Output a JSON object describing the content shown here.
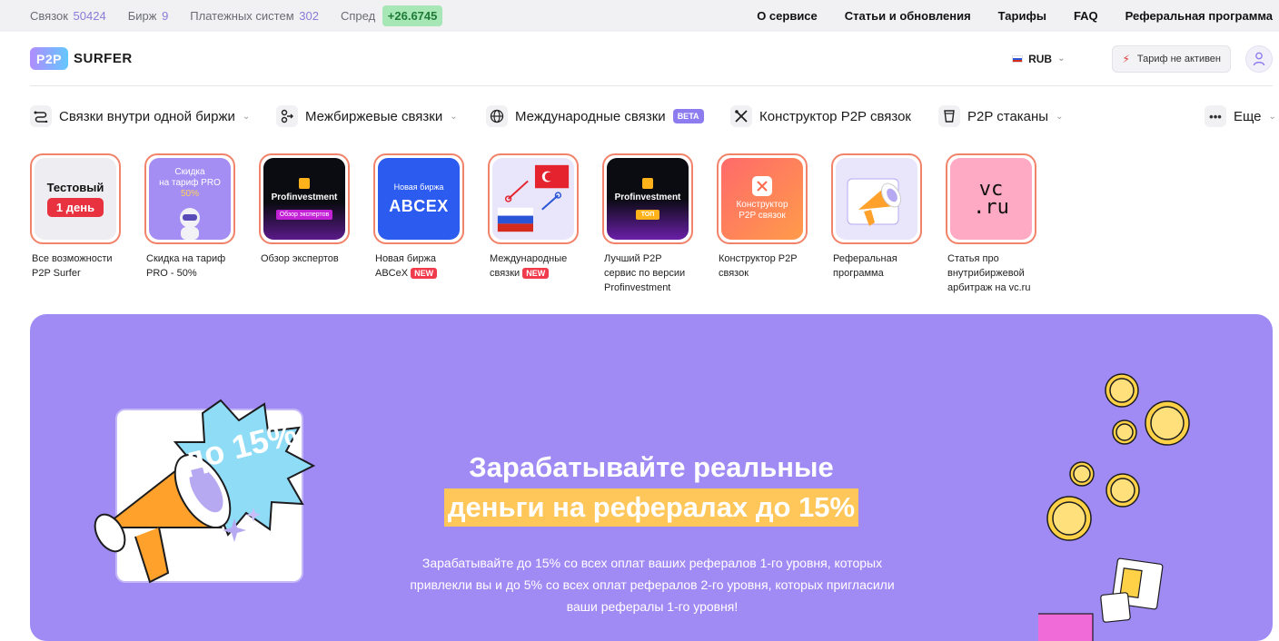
{
  "topbar": {
    "stats": [
      {
        "label": "Связок",
        "value": "50424"
      },
      {
        "label": "Бирж",
        "value": "9"
      },
      {
        "label": "Платежных систем",
        "value": "302"
      }
    ],
    "spread_label": "Спред",
    "spread_value": "+26.6745",
    "nav": [
      "О сервисе",
      "Статьи и обновления",
      "Тарифы",
      "FAQ",
      "Реферальная программа"
    ]
  },
  "header": {
    "logo_badge": "P2P",
    "logo_text": "SURFER",
    "currency": "RUB",
    "tariff_button": "Тариф не активен"
  },
  "menu": {
    "items": [
      {
        "label": "Связки внутри одной биржи",
        "icon": "route-icon"
      },
      {
        "label": "Межбиржевые связки",
        "icon": "exchange-icon"
      },
      {
        "label": "Международные связки",
        "icon": "globe-icon",
        "badge": "BETA"
      },
      {
        "label": "Конструктор P2P связок",
        "icon": "tools-icon"
      },
      {
        "label": "P2P стаканы",
        "icon": "cup-icon"
      }
    ],
    "more_label": "Еще"
  },
  "stories": [
    {
      "thumb_lines": [
        "Тестовый",
        "1 день"
      ],
      "caption": "Все возможности P2P Surfer"
    },
    {
      "thumb_lines": [
        "Скидка",
        "на тариф PRO",
        "50%"
      ],
      "caption": "Скидка на тариф PRO - 50%"
    },
    {
      "thumb_lines": [
        "Profinvestment",
        "Обзор экспертов"
      ],
      "caption": "Обзор экспертов"
    },
    {
      "thumb_lines": [
        "Новая биржа",
        "ABCEX"
      ],
      "caption": "Новая биржа ABCeX",
      "badge": "NEW"
    },
    {
      "thumb_lines": [],
      "caption": "Международные связки",
      "badge": "NEW"
    },
    {
      "thumb_lines": [
        "Profinvestment",
        "ТОП"
      ],
      "caption": "Лучший P2P сервис по версии Profinvestment"
    },
    {
      "thumb_lines": [
        "Конструктор",
        "P2P связок"
      ],
      "caption": "Конструктор P2P связок"
    },
    {
      "thumb_lines": [],
      "caption": "Реферальная программа"
    },
    {
      "thumb_lines": [
        "vc",
        ".ru"
      ],
      "caption": "Статья про внутрибиржевой арбитраж на vc.ru"
    }
  ],
  "banner": {
    "sticker_text": "до 15%",
    "title_line1": "Зарабатывайте реальные",
    "title_line2": "деньги на рефералах до 15%",
    "description": "Зарабатывайте до 15% со всех оплат ваших рефералов 1-го уровня, которых привлекли вы и до 5% со всех оплат рефералов 2-го уровня, которых пригласили ваши рефералы 1-го уровня!"
  },
  "colors": {
    "banner_bg": "#a08bf5",
    "highlight": "#ffc65a",
    "story_ring": "#f2836b",
    "spread_bg": "#a6e7b5"
  }
}
